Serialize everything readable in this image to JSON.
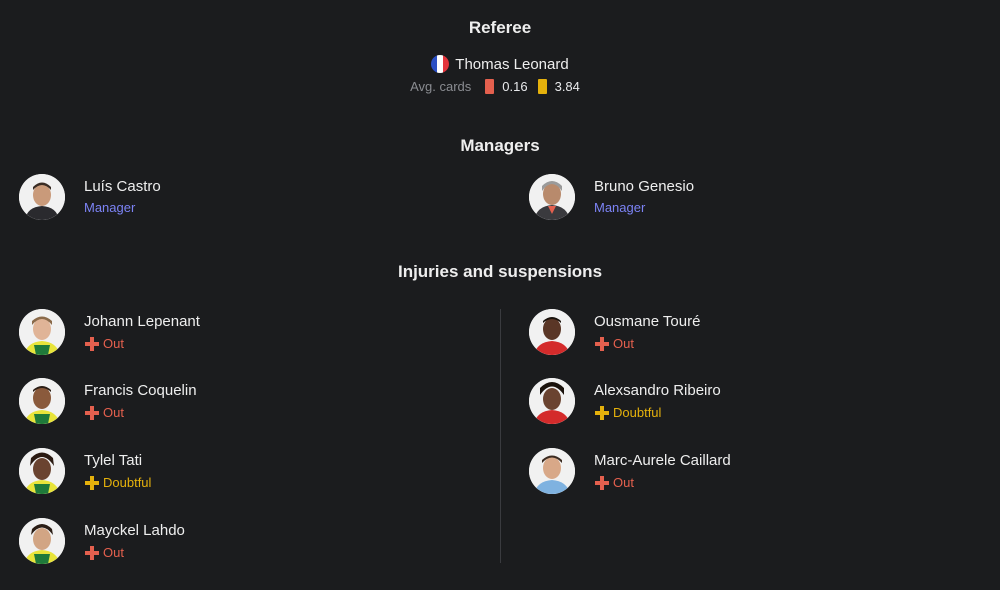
{
  "referee": {
    "title": "Referee",
    "name": "Thomas Leonard",
    "avg_cards_label": "Avg. cards",
    "red_avg": "0.16",
    "yellow_avg": "3.84",
    "red_color": "#e4604e",
    "yellow_color": "#e5b10c"
  },
  "managers": {
    "title": "Managers",
    "items": [
      {
        "name": "Luís Castro",
        "role": "Manager"
      },
      {
        "name": "Bruno Genesio",
        "role": "Manager"
      }
    ]
  },
  "injuries": {
    "title": "Injuries and suspensions",
    "home": [
      {
        "name": "Johann Lepenant",
        "status": "Out",
        "icon": "plus-icon"
      },
      {
        "name": "Francis Coquelin",
        "status": "Out",
        "icon": "plus-icon"
      },
      {
        "name": "Tylel Tati",
        "status": "Doubtful",
        "icon": "plus-icon"
      },
      {
        "name": "Mayckel Lahdo",
        "status": "Out",
        "icon": "plus-icon"
      }
    ],
    "away": [
      {
        "name": "Ousmane Touré",
        "status": "Out",
        "icon": "plus-icon"
      },
      {
        "name": "Alexsandro Ribeiro",
        "status": "Doubtful",
        "icon": "plus-icon"
      },
      {
        "name": "Marc-Aurele Caillard",
        "status": "Out",
        "icon": "plus-icon"
      }
    ]
  },
  "colors": {
    "role": "#7c83f5",
    "out": "#e4604e",
    "doubtful": "#e5b10c"
  }
}
